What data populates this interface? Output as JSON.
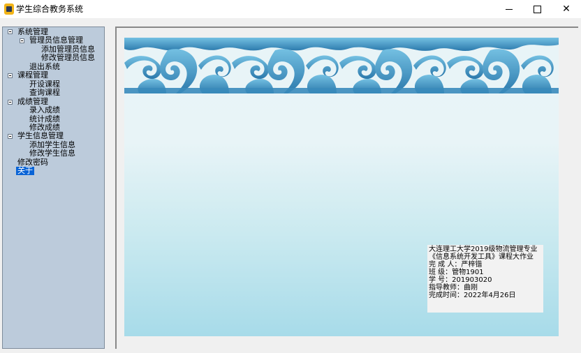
{
  "window": {
    "title": "学生综合教务系统",
    "icon": "app-icon"
  },
  "tree": [
    {
      "label": "系统管理",
      "level": 0,
      "expanded": true
    },
    {
      "label": "管理员信息管理",
      "level": 1,
      "expanded": true
    },
    {
      "label": "添加管理员信息",
      "level": 2
    },
    {
      "label": "修改管理员信息",
      "level": 2
    },
    {
      "label": "退出系统",
      "level": 1
    },
    {
      "label": "课程管理",
      "level": 0,
      "expanded": true
    },
    {
      "label": "开设课程",
      "level": 1
    },
    {
      "label": "查询课程",
      "level": 1
    },
    {
      "label": "成绩管理",
      "level": 0,
      "expanded": true
    },
    {
      "label": "录入成绩",
      "level": 1
    },
    {
      "label": "统计成绩",
      "level": 1
    },
    {
      "label": "修改成绩",
      "level": 1
    },
    {
      "label": "学生信息管理",
      "level": 0,
      "expanded": true
    },
    {
      "label": "添加学生信息",
      "level": 1
    },
    {
      "label": "修改学生信息",
      "level": 1
    },
    {
      "label": "修改密码",
      "level": 0
    },
    {
      "label": "关于",
      "level": 0,
      "selected": true
    }
  ],
  "info": {
    "line1": "大连理工大学2019级物流管理专业",
    "line2": "《信息系统开发工具》课程大作业",
    "line3": "完    成    人：严梓锴",
    "line4": "班              级：管物1901",
    "line5": "学              号：201903020",
    "line6": "指导教师：曲刚",
    "line7": "完成时间：2022年4月26日"
  },
  "colors": {
    "tree_bg": "#bccbdb",
    "selection": "#0a64d6",
    "banner_ornament": "#2f7fb1",
    "banner_ornament_light": "#6fb7d8"
  }
}
